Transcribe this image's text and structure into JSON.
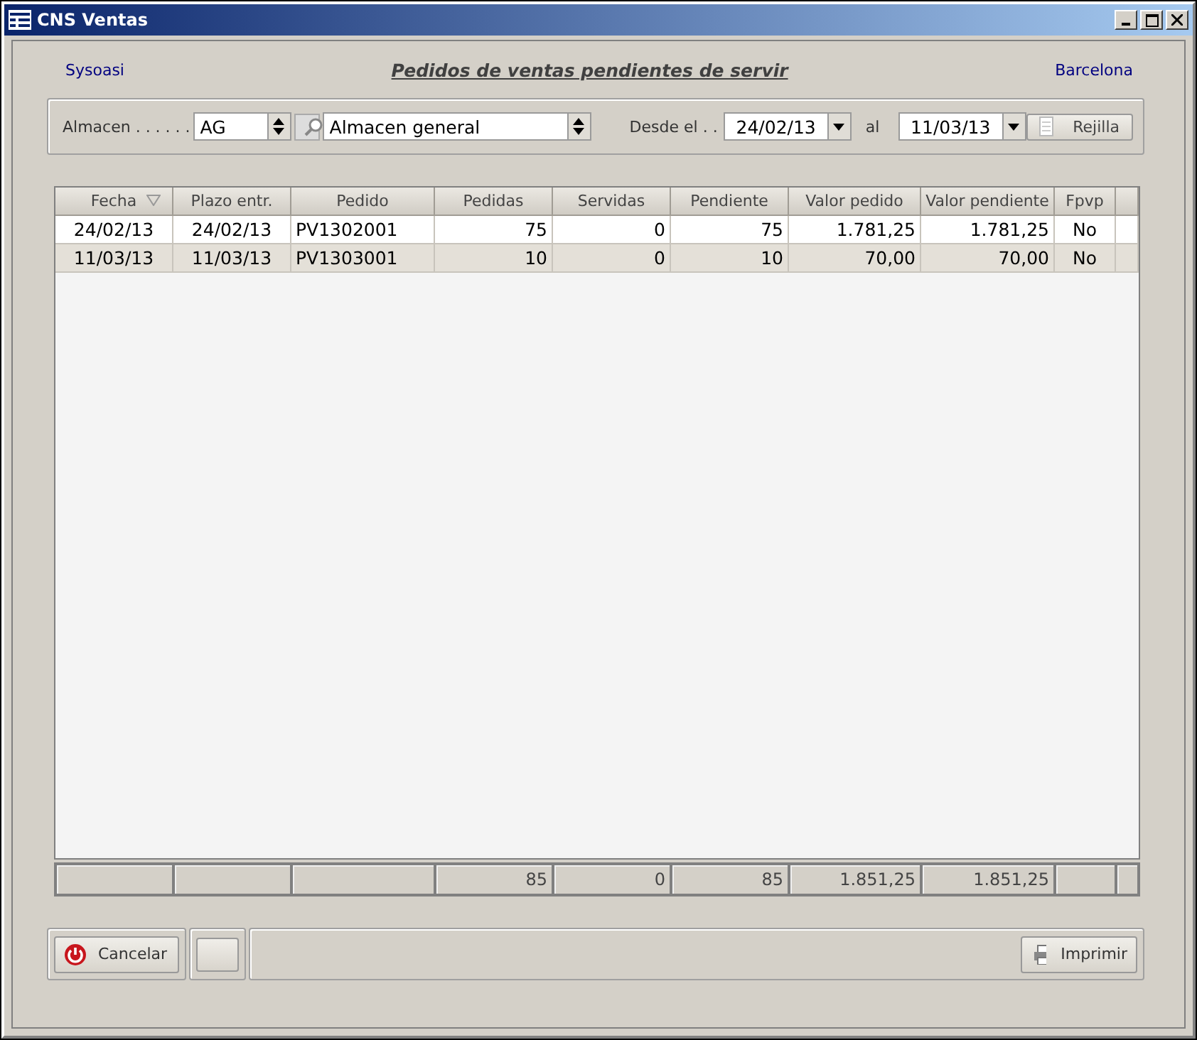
{
  "window": {
    "title": "CNS Ventas"
  },
  "header": {
    "left": "Sysoasi",
    "title": "Pedidos de ventas pendientes de servir",
    "right": "Barcelona"
  },
  "filter": {
    "almacen_label": "Almacen . . . . . .",
    "almacen_code": "AG",
    "almacen_name": "Almacen general",
    "desde_label": "Desde el . .",
    "desde": "24/02/13",
    "al_label": "al",
    "al": "11/03/13",
    "grid_button": "Rejilla"
  },
  "table": {
    "columns": [
      {
        "label": "Fecha",
        "kind": "date",
        "sorted": true
      },
      {
        "label": "Plazo entr.",
        "kind": "date",
        "sorted": false
      },
      {
        "label": "Pedido",
        "kind": "text",
        "sorted": false
      },
      {
        "label": "Pedidas",
        "kind": "number",
        "sorted": false
      },
      {
        "label": "Servidas",
        "kind": "number",
        "sorted": false
      },
      {
        "label": "Pendiente",
        "kind": "number",
        "sorted": false
      },
      {
        "label": "Valor pedido",
        "kind": "number",
        "sorted": false
      },
      {
        "label": "Valor pendiente",
        "kind": "number",
        "sorted": false
      },
      {
        "label": "Fpvp",
        "kind": "flag",
        "sorted": false
      }
    ],
    "rows": [
      [
        "24/02/13",
        "24/02/13",
        "PV1302001",
        "75",
        "0",
        "75",
        "1.781,25",
        "1.781,25",
        "No"
      ],
      [
        "11/03/13",
        "11/03/13",
        "PV1303001",
        "10",
        "0",
        "10",
        "70,00",
        "70,00",
        "No"
      ]
    ]
  },
  "totals": {
    "pedidas": "85",
    "servidas": "0",
    "pendiente": "85",
    "valor_pedido": "1.851,25",
    "valor_pendiente": "1.851,25"
  },
  "buttons": {
    "cancel": "Cancelar",
    "print": "Imprimir"
  }
}
